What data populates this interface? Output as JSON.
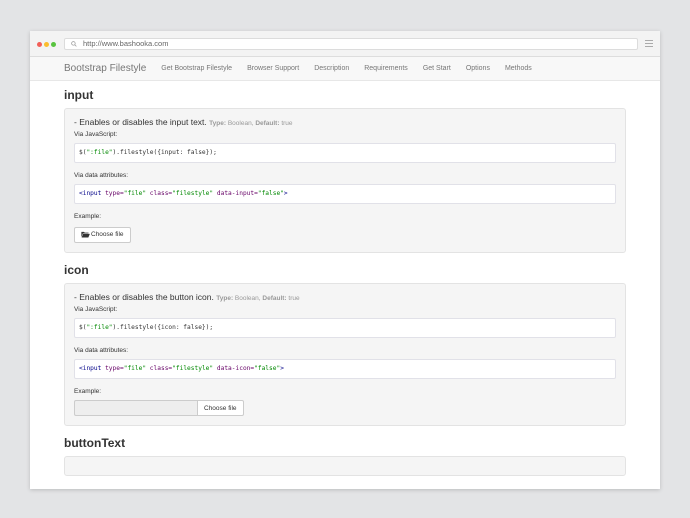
{
  "browser": {
    "url": "http://www.bashooka.com"
  },
  "navbar": {
    "brand": "Bootstrap Filestyle",
    "items": [
      "Get Bootstrap Filestyle",
      "Browser Support",
      "Description",
      "Requirements",
      "Get Start",
      "Options",
      "Methods"
    ]
  },
  "sections": {
    "input": {
      "title": "input",
      "desc": "- Enables or disables the input text.",
      "type_label": "Type:",
      "type_value": "Boolean,",
      "default_label": "Default:",
      "default_value": "true",
      "via_js": "Via JavaScript:",
      "js_sel": "\":file\"",
      "js_prefix": "$(",
      "js_suffix": ").filestyle({input: false});",
      "via_data": "Via data attributes:",
      "data_open": "<input",
      "data_type_attr": " type=",
      "data_type_val": "\"file\"",
      "data_class_attr": " class=",
      "data_class_val": "\"filestyle\"",
      "data_opt_attr": " data-input=",
      "data_opt_val": "\"false\"",
      "data_close": ">",
      "example": "Example:",
      "button": "Choose file"
    },
    "icon": {
      "title": "icon",
      "desc": "- Enables or disables the button icon.",
      "type_label": "Type:",
      "type_value": "Boolean,",
      "default_label": "Default:",
      "default_value": "true",
      "via_js": "Via JavaScript:",
      "js_sel": "\":file\"",
      "js_prefix": "$(",
      "js_suffix": ").filestyle({icon: false});",
      "via_data": "Via data attributes:",
      "data_open": "<input",
      "data_type_attr": " type=",
      "data_type_val": "\"file\"",
      "data_class_attr": " class=",
      "data_class_val": "\"filestyle\"",
      "data_opt_attr": " data-icon=",
      "data_opt_val": "\"false\"",
      "data_close": ">",
      "example": "Example:",
      "button": "Choose file"
    },
    "buttonText": {
      "title": "buttonText"
    }
  },
  "colors": {
    "string": "#008800",
    "tag": "#000088",
    "attr": "#660066"
  }
}
